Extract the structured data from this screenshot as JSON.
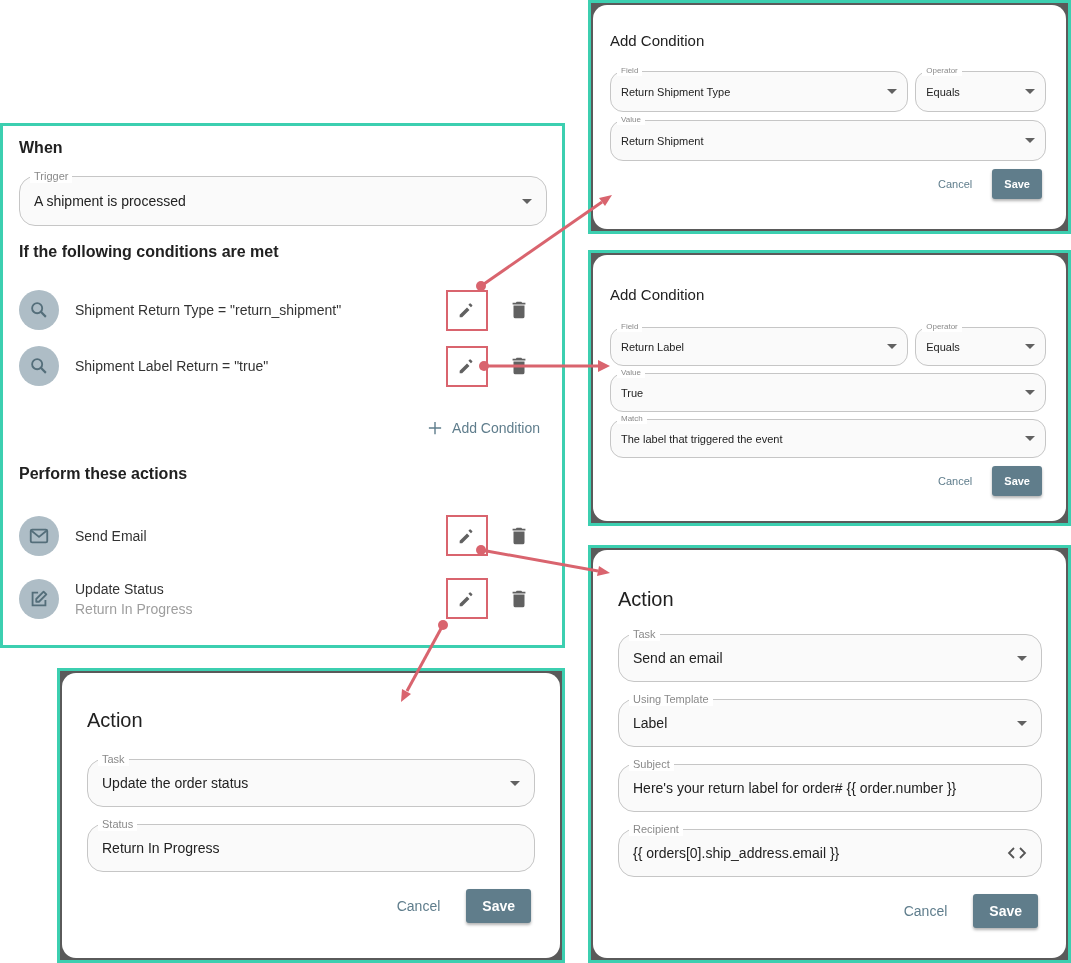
{
  "rule": {
    "when_heading": "When",
    "trigger": {
      "label": "Trigger",
      "value": "A shipment is processed",
      "kind": "select"
    },
    "conditions_heading": "If the following conditions are met",
    "conditions": [
      {
        "kind": "search",
        "text": "Shipment Return Type = \"return_shipment\"",
        "highlighted": true
      },
      {
        "kind": "search",
        "text": "Shipment Label Return = \"true\"",
        "highlighted": true
      }
    ],
    "add_condition": "Add Condition",
    "actions_heading": "Perform these actions",
    "actions": [
      {
        "kind": "mail",
        "title": "Send Email",
        "highlighted": true
      },
      {
        "kind": "edit",
        "title": "Update Status",
        "subtitle": "Return In Progress",
        "highlighted": true
      }
    ]
  },
  "dialogs": [
    {
      "title": "Add Condition",
      "rows": [
        [
          {
            "label": "Field",
            "value": "Return Shipment Type",
            "kind": "select"
          },
          {
            "label": "Operator",
            "value": "Equals",
            "kind": "select"
          }
        ],
        [
          {
            "label": "Value",
            "value": "Return Shipment",
            "kind": "select"
          }
        ]
      ],
      "cancel": "Cancel",
      "save": "Save"
    },
    {
      "title": "Add Condition",
      "rows": [
        [
          {
            "label": "Field",
            "value": "Return Label",
            "kind": "select"
          },
          {
            "label": "Operator",
            "value": "Equals",
            "kind": "select"
          }
        ],
        [
          {
            "label": "Value",
            "value": "True",
            "kind": "select"
          }
        ],
        [
          {
            "label": "Match",
            "value": "The label that triggered the event",
            "kind": "select"
          }
        ]
      ],
      "cancel": "Cancel",
      "save": "Save"
    },
    {
      "title": "Action",
      "rows": [
        [
          {
            "label": "Task",
            "value": "Update the order status",
            "kind": "select"
          }
        ],
        [
          {
            "label": "Status",
            "value": "Return In Progress",
            "kind": "text"
          }
        ]
      ],
      "cancel": "Cancel",
      "save": "Save"
    },
    {
      "title": "Action",
      "rows": [
        [
          {
            "label": "Task",
            "value": "Send an email",
            "kind": "select"
          }
        ],
        [
          {
            "label": "Using Template",
            "value": "Label",
            "kind": "select"
          }
        ],
        [
          {
            "label": "Subject",
            "value": "Here's your return label for order# {{ order.number }}",
            "kind": "text"
          }
        ],
        [
          {
            "label": "Recipient",
            "value": "{{ orders[0].ship_address.email }}",
            "kind": "code"
          }
        ]
      ],
      "cancel": "Cancel",
      "save": "Save"
    }
  ]
}
